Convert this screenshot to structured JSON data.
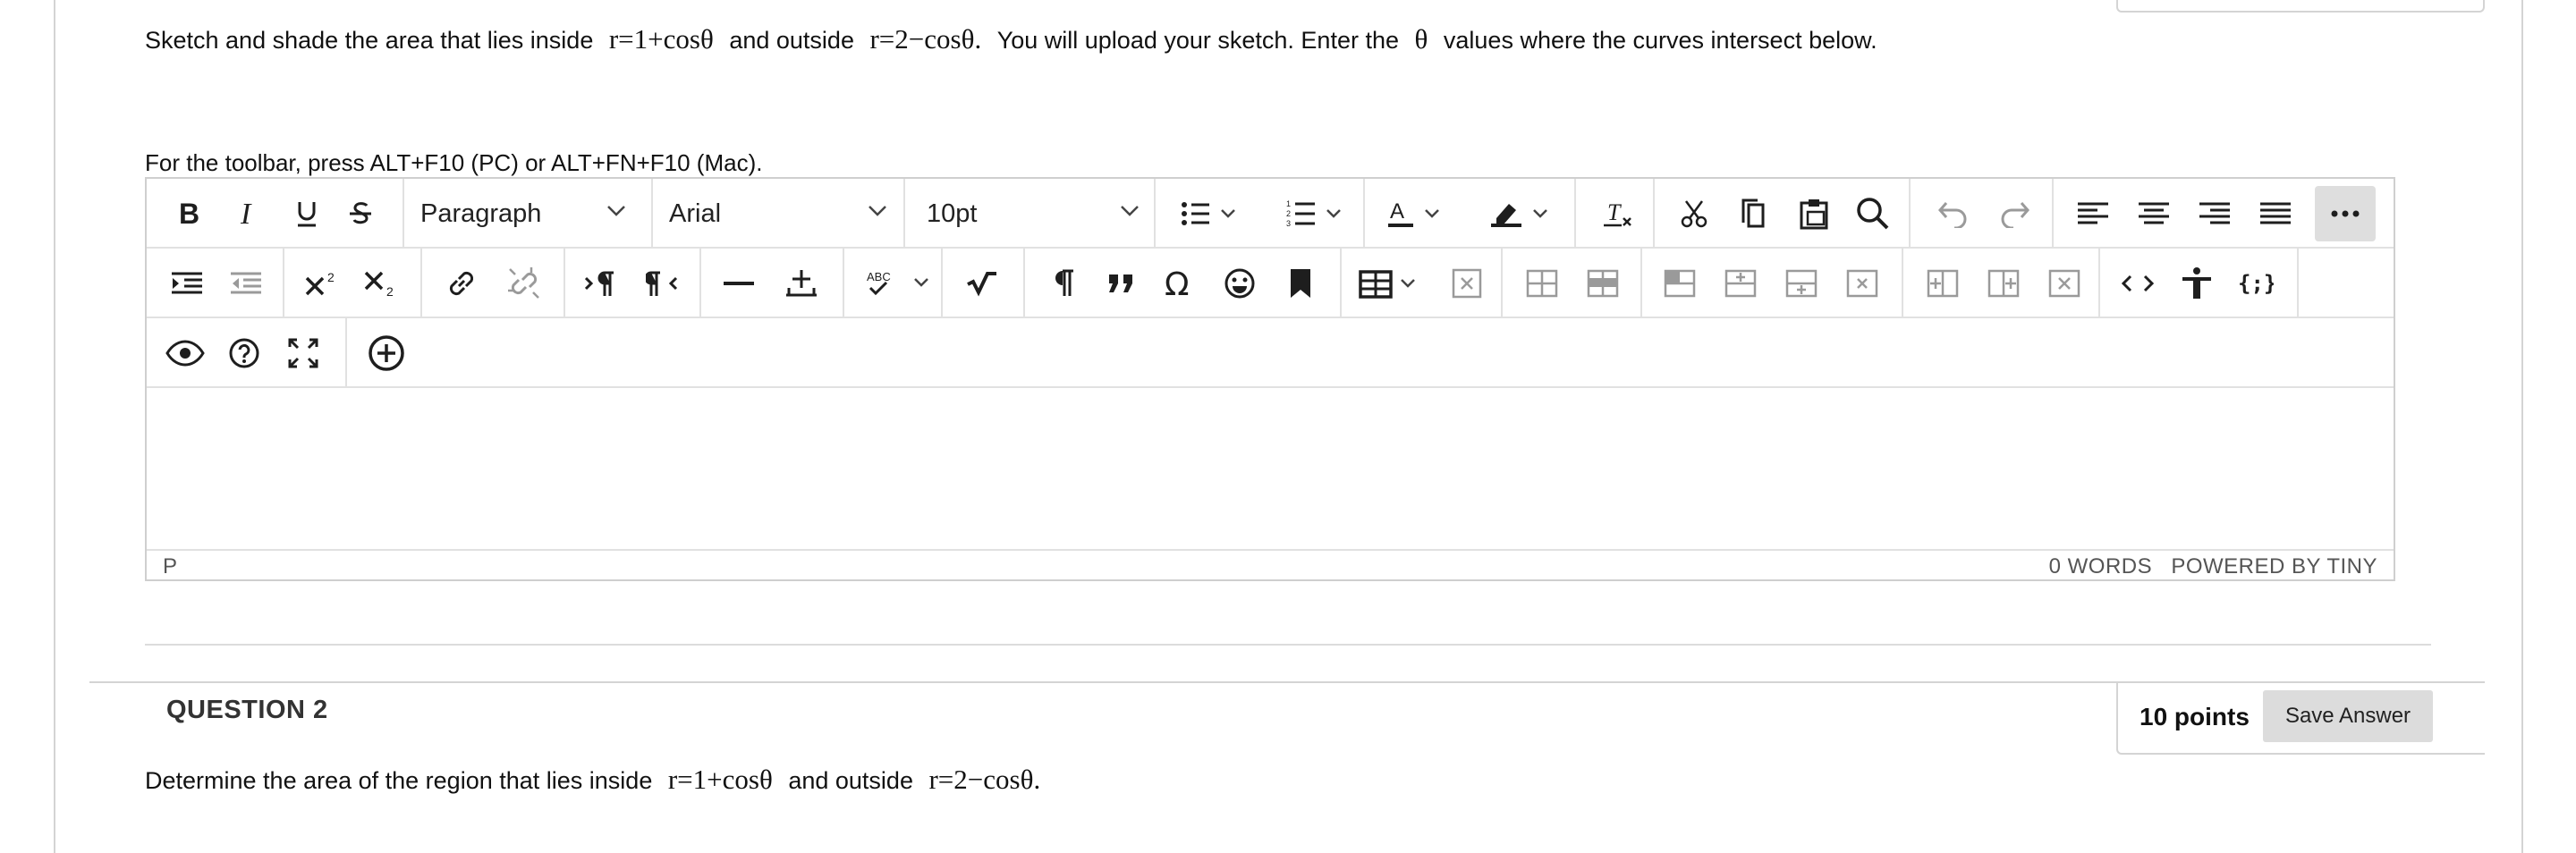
{
  "question1": {
    "prompt_parts": {
      "a": "Sketch and shade the area that lies inside",
      "eq1": "r=1+cosθ",
      "b": "and outside",
      "eq2": "r=2−cosθ.",
      "c": "You will upload your sketch.  Enter the",
      "theta": "θ",
      "d": "values where the curves intersect below."
    },
    "toolbar_hint": "For the toolbar, press ALT+F10 (PC) or ALT+FN+F10 (Mac).",
    "editor": {
      "block_format": "Paragraph",
      "font_family": "Arial",
      "font_size": "10pt",
      "status_path": "P",
      "word_count": "0 WORDS",
      "powered_by": "POWERED BY TINY",
      "icons_row1": [
        "bold-icon",
        "italic-icon",
        "underline-icon",
        "strikethrough-icon",
        "bullet-list-icon",
        "numbered-list-icon",
        "text-color-icon",
        "highlight-icon",
        "clear-format-icon",
        "cut-icon",
        "copy-icon",
        "paste-icon",
        "search-icon",
        "undo-icon",
        "redo-icon",
        "align-left-icon",
        "align-center-icon",
        "align-right-icon",
        "justify-icon",
        "more-icon"
      ],
      "icons_row2": [
        "indent-icon",
        "outdent-icon",
        "superscript-icon",
        "subscript-icon",
        "link-icon",
        "unlink-icon",
        "ltr-icon",
        "rtl-icon",
        "horizontal-rule-icon",
        "plus-minus-icon",
        "spellcheck-icon",
        "math-icon",
        "paragraph-icon",
        "quote-icon",
        "omega-icon",
        "emoji-icon",
        "bookmark-icon",
        "table-icon",
        "delete-table-icon",
        "table-row-icon",
        "table-col-icon",
        "code-icon",
        "accessibility-icon",
        "template-icon"
      ],
      "icons_row3": [
        "preview-icon",
        "help-icon",
        "fullscreen-icon",
        "add-content-icon"
      ]
    }
  },
  "question2": {
    "title": "QUESTION 2",
    "points": "10 points",
    "save_label": "Save Answer",
    "prompt_parts": {
      "a": "Determine the area of the region that lies inside",
      "eq1": "r=1+cosθ",
      "b": "and outside",
      "eq2": "r=2−cosθ."
    }
  },
  "colors": {
    "button_bg": "#dcdcdc",
    "border": "#cfcfcf",
    "icon": "#1e1e1e"
  }
}
